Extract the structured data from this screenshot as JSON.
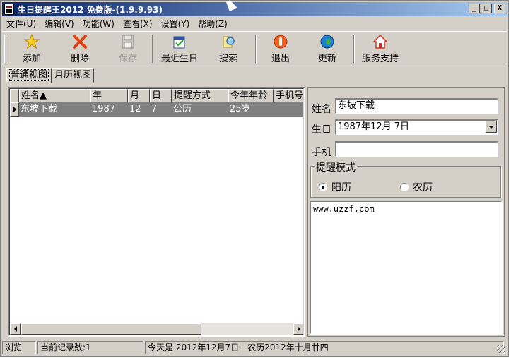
{
  "window": {
    "title": "生日提醒王2012 免费版-(1.9.9.93)",
    "min": "_",
    "max": "□",
    "close": "X"
  },
  "menu": [
    "文件(U)",
    "编辑(V)",
    "功能(W)",
    "查看(X)",
    "设置(Y)",
    "帮助(Z)"
  ],
  "toolbar": {
    "add": "添加",
    "delete": "删除",
    "save": "保存",
    "recent": "最近生日",
    "search": "搜索",
    "exit": "退出",
    "update": "更新",
    "support": "服务支持"
  },
  "tabs": [
    "普通视图",
    "月历视图"
  ],
  "grid": {
    "headers": [
      "姓名▲",
      "年",
      "月",
      "日",
      "提醒方式",
      "今年年龄",
      "手机号"
    ],
    "rows": [
      {
        "name": "东坡下载",
        "year": "1987",
        "month": "12",
        "day": "7",
        "remind": "公历",
        "age": "25岁",
        "phone": ""
      }
    ]
  },
  "detail": {
    "name_label": "姓名",
    "name_value": "东坡下载",
    "birthday_label": "生日",
    "birthday_value": "1987年12月 7日",
    "phone_label": "手机",
    "phone_value": "",
    "mode_title": "提醒模式",
    "mode_solar": "阳历",
    "mode_lunar": "农历",
    "mode_selected": "阳历",
    "memo": "www.uzzf.com"
  },
  "status": {
    "mode": "浏览",
    "count": "当前记录数:1",
    "today": "今天是 2012年12月7日－农历2012年十月廿四"
  }
}
